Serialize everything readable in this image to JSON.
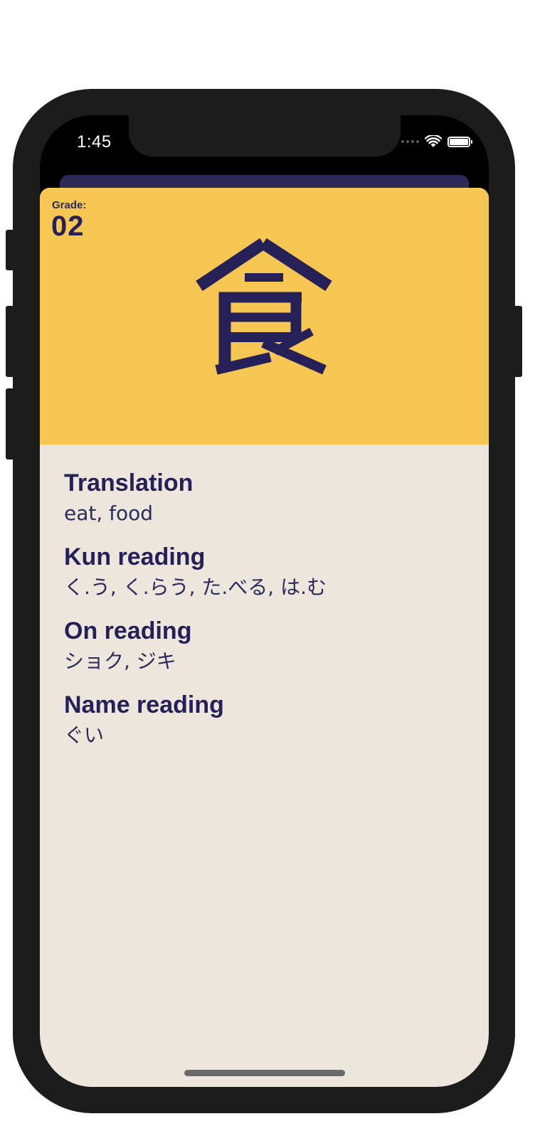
{
  "status_bar": {
    "time": "1:45",
    "signal_icon": "cellular-signal-icon",
    "wifi_icon": "wifi-icon",
    "battery_icon": "battery-icon"
  },
  "card": {
    "grade_label": "Grade:",
    "grade_value": "02",
    "kanji": "食",
    "sections": [
      {
        "title": "Translation",
        "value": "eat, food"
      },
      {
        "title": "Kun reading",
        "value": "く.う, く.らう, た.べる, は.む"
      },
      {
        "title": "On reading",
        "value": "ショク, ジキ"
      },
      {
        "title": "Name reading",
        "value": "ぐい"
      }
    ]
  },
  "colors": {
    "accent_yellow": "#f5c651",
    "navy": "#252158",
    "card_background": "#ece6dd"
  }
}
